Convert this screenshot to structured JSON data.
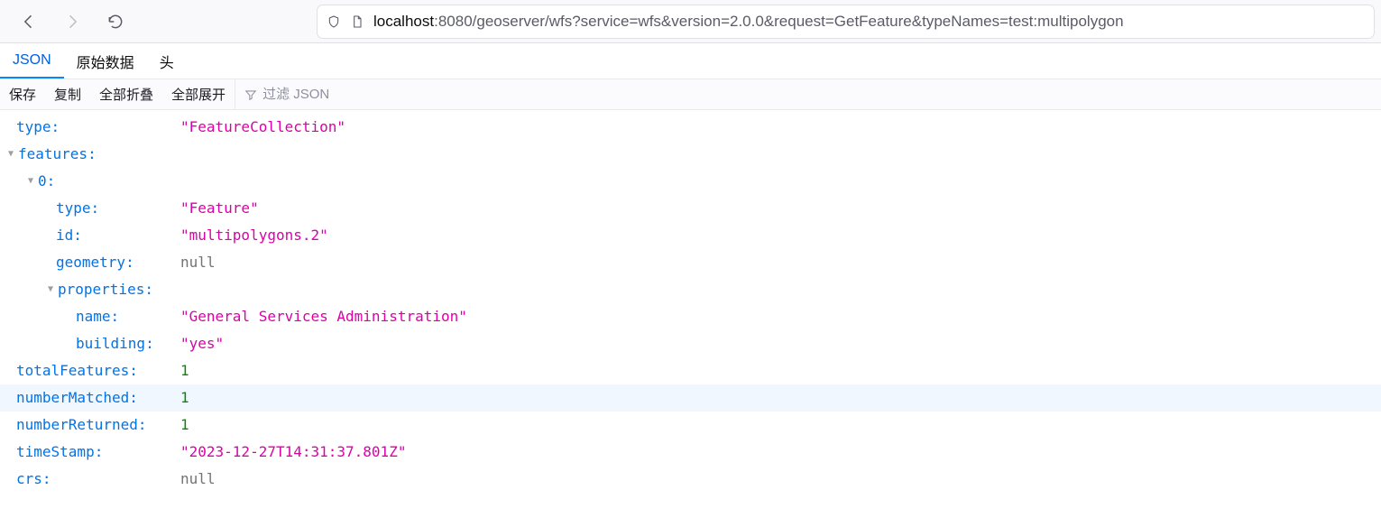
{
  "chrome": {
    "back_icon": "back-icon",
    "forward_icon": "forward-icon",
    "reload_icon": "reload-icon",
    "shield_icon": "shield-icon",
    "page_icon": "page-icon",
    "url_host": "localhost",
    "url_rest": ":8080/geoserver/wfs?service=wfs&version=2.0.0&request=GetFeature&typeNames=test:multipolygon"
  },
  "dev_tabs": {
    "json": "JSON",
    "raw": "原始数据",
    "headers": "头"
  },
  "toolbar": {
    "save": "保存",
    "copy": "复制",
    "collapse_all": "全部折叠",
    "expand_all": "全部展开",
    "filter_placeholder": "过滤 JSON"
  },
  "json": {
    "type_key": "type",
    "type_val": "\"FeatureCollection\"",
    "features_key": "features",
    "idx0_key": "0",
    "f_type_key": "type",
    "f_type_val": "\"Feature\"",
    "f_id_key": "id",
    "f_id_val": "\"multipolygons.2\"",
    "f_geom_key": "geometry",
    "f_geom_val": "null",
    "f_props_key": "properties",
    "p_name_key": "name",
    "p_name_val": "\"General Services Administration\"",
    "p_building_key": "building",
    "p_building_val": "\"yes\"",
    "totalFeatures_key": "totalFeatures",
    "totalFeatures_val": "1",
    "numberMatched_key": "numberMatched",
    "numberMatched_val": "1",
    "numberReturned_key": "numberReturned",
    "numberReturned_val": "1",
    "timeStamp_key": "timeStamp",
    "timeStamp_val": "\"2023-12-27T14:31:37.801Z\"",
    "crs_key": "crs",
    "crs_val": "null"
  }
}
